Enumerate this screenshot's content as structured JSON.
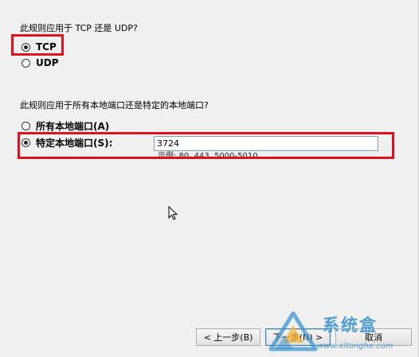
{
  "protocol": {
    "question": "此规则应用于 TCP 还是 UDP?",
    "options": [
      {
        "label": "TCP",
        "selected": true
      },
      {
        "label": "UDP",
        "selected": false
      }
    ]
  },
  "ports": {
    "question": "此规则应用于所有本地端口还是特定的本地端口?",
    "options": [
      {
        "label": "所有本地端口(A)",
        "selected": false
      },
      {
        "label": "特定本地端口(S):",
        "selected": true
      }
    ],
    "value": "3724",
    "example": "示例: 80, 443, 5000-5010"
  },
  "buttons": {
    "back": "< 上一步(B)",
    "next": "下一步(N) >",
    "cancel": "取消"
  },
  "watermark": {
    "title": "系统盒",
    "url": "www.xitonghe.com"
  },
  "colors": {
    "highlight": "#e0111e",
    "watermark": "#3e95d3"
  }
}
